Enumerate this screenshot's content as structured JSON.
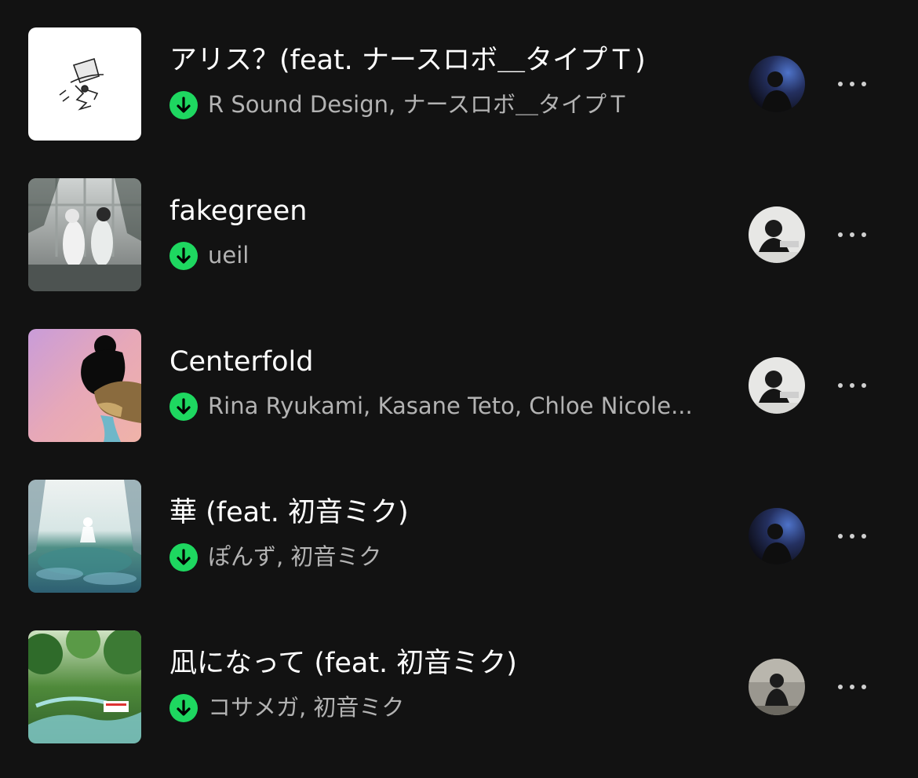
{
  "tracks": [
    {
      "title": "アリス？(feat. ナースロボ＿タイプＴ)",
      "artists": "R Sound Design, ナースロボ＿タイプＴ",
      "downloaded": true,
      "cover_icon": "album-cover-top-hat-illustration",
      "avatar_icon": "added-by-avatar"
    },
    {
      "title": "fakegreen",
      "artists": "ueil",
      "downloaded": true,
      "cover_icon": "album-cover-two-figures-window",
      "avatar_icon": "added-by-avatar"
    },
    {
      "title": "Centerfold",
      "artists": "Rina Ryukami, Kasane Teto, Chloe Nicole...",
      "downloaded": true,
      "cover_icon": "album-cover-pink-silhouette",
      "avatar_icon": "added-by-avatar"
    },
    {
      "title": "華 (feat. 初音ミク)",
      "artists": "ぽんず, 初音ミク",
      "downloaded": true,
      "cover_icon": "album-cover-water-scene",
      "avatar_icon": "added-by-avatar"
    },
    {
      "title": "凪になって (feat. 初音ミク)",
      "artists": "コサメガ, 初音ミク",
      "downloaded": true,
      "cover_icon": "album-cover-green-park",
      "avatar_icon": "added-by-avatar"
    }
  ],
  "colors": {
    "background": "#121212",
    "title": "#ffffff",
    "subtitle": "#b3b3b3",
    "download_badge": "#1ed760",
    "more_dots": "#cfcfcf"
  },
  "icons": {
    "download": "download-arrow-icon",
    "more": "more-options-icon"
  }
}
